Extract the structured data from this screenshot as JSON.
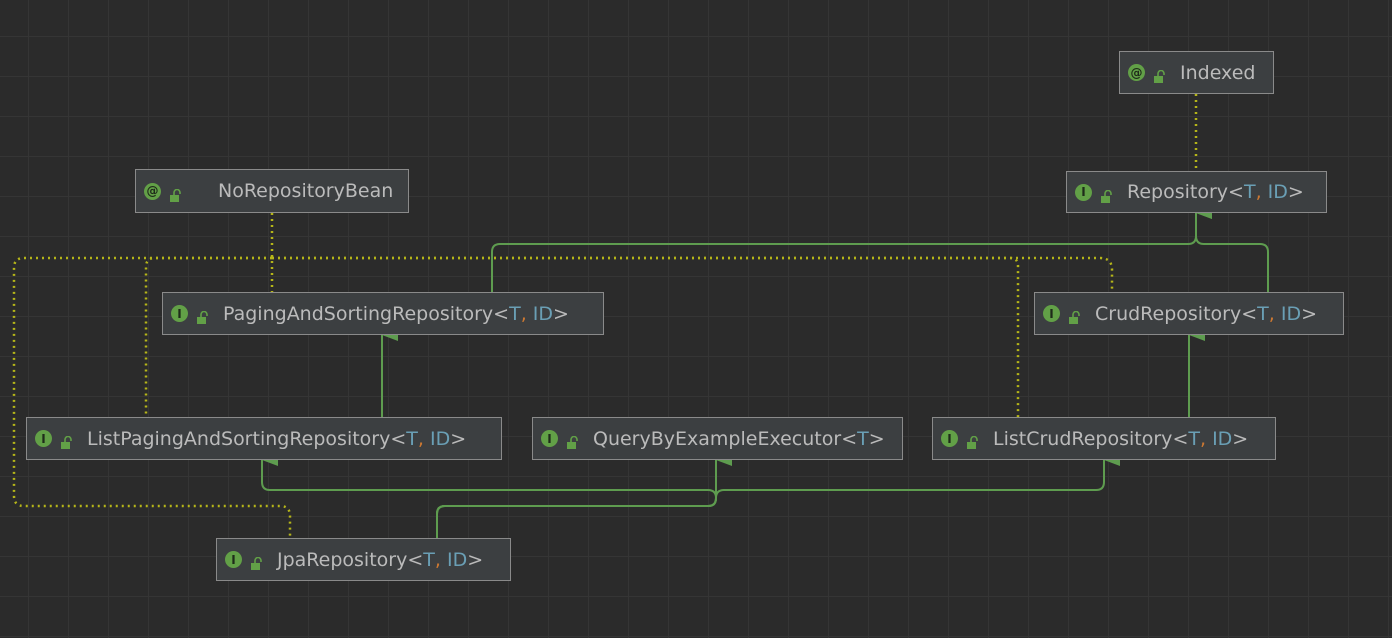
{
  "diagram": {
    "nodes": {
      "indexed": {
        "kind": "annotation",
        "badge": "@",
        "name": "Indexed",
        "params": []
      },
      "no_repository_bean": {
        "kind": "annotation",
        "badge": "@",
        "name": "NoRepositoryBean",
        "params": []
      },
      "repository": {
        "kind": "interface",
        "badge": "I",
        "name": "Repository",
        "params": [
          "T",
          "ID"
        ]
      },
      "paging_and_sorting_repository": {
        "kind": "interface",
        "badge": "I",
        "name": "PagingAndSortingRepository",
        "params": [
          "T",
          "ID"
        ]
      },
      "crud_repository": {
        "kind": "interface",
        "badge": "I",
        "name": "CrudRepository",
        "params": [
          "T",
          "ID"
        ]
      },
      "list_paging_and_sorting_repository": {
        "kind": "interface",
        "badge": "I",
        "name": "ListPagingAndSortingRepository",
        "params": [
          "T",
          "ID"
        ]
      },
      "query_by_example_executor": {
        "kind": "interface",
        "badge": "I",
        "name": "QueryByExampleExecutor",
        "params": [
          "T"
        ]
      },
      "list_crud_repository": {
        "kind": "interface",
        "badge": "I",
        "name": "ListCrudRepository",
        "params": [
          "T",
          "ID"
        ]
      },
      "jpa_repository": {
        "kind": "interface",
        "badge": "I",
        "name": "JpaRepository",
        "params": [
          "T",
          "ID"
        ]
      }
    },
    "colors": {
      "background": "#2b2b2b",
      "node_fill": "#3c3f41",
      "node_border": "#8a8a8a",
      "text": "#bbbbbb",
      "type_param": "#6a9fb5",
      "comma": "#cc7832",
      "badge": "#62a047",
      "inheritance_edge": "#5e9c4f",
      "annotation_edge": "#b5b519"
    }
  }
}
